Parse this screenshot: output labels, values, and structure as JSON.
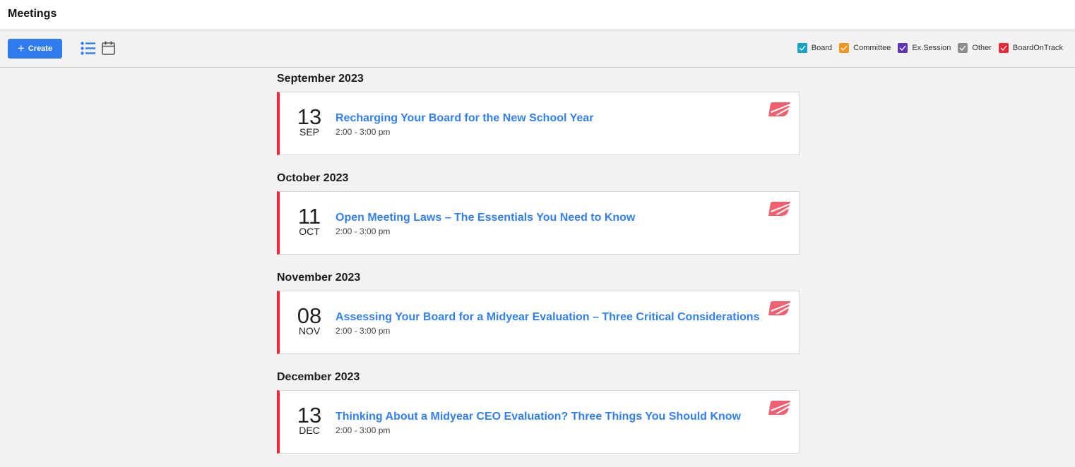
{
  "header": {
    "title": "Meetings"
  },
  "toolbar": {
    "create_label": "Create",
    "create_icon": "plus-icon",
    "views": [
      {
        "name": "list-view",
        "icon": "list-icon",
        "active": true
      },
      {
        "name": "calendar-view",
        "icon": "calendar-icon",
        "active": false
      }
    ],
    "legend": [
      {
        "label": "Board",
        "color": "#16a4c3",
        "checked": true
      },
      {
        "label": "Committee",
        "color": "#f7941d",
        "checked": true
      },
      {
        "label": "Ex.Session",
        "color": "#5e35b8",
        "checked": true
      },
      {
        "label": "Other",
        "color": "#8e8e8e",
        "checked": true
      },
      {
        "label": "BoardOnTrack",
        "color": "#ee2737",
        "checked": true
      }
    ]
  },
  "colors": {
    "accent": "#2f7bef",
    "link": "#3280ee",
    "boardontrack": "#ee2737",
    "boardontrack_icon": "#f06070"
  },
  "months": [
    {
      "heading": "September 2023",
      "meetings": [
        {
          "day": "13",
          "month": "SEP",
          "title": "Recharging Your Board for the New School Year",
          "time": "2:00 - 3:00 pm",
          "type": "BoardOnTrack",
          "icon": "boardontrack-logo-icon"
        }
      ]
    },
    {
      "heading": "October 2023",
      "meetings": [
        {
          "day": "11",
          "month": "OCT",
          "title": "Open Meeting Laws – The Essentials You Need to Know",
          "time": "2:00 - 3:00 pm",
          "type": "BoardOnTrack",
          "icon": "boardontrack-logo-icon"
        }
      ]
    },
    {
      "heading": "November 2023",
      "meetings": [
        {
          "day": "08",
          "month": "NOV",
          "title": "Assessing Your Board for a Midyear Evaluation – Three Critical Considerations",
          "time": "2:00 - 3:00 pm",
          "type": "BoardOnTrack",
          "icon": "boardontrack-logo-icon"
        }
      ]
    },
    {
      "heading": "December 2023",
      "meetings": [
        {
          "day": "13",
          "month": "DEC",
          "title": "Thinking About a Midyear CEO Evaluation? Three Things You Should Know",
          "time": "2:00 - 3:00 pm",
          "type": "BoardOnTrack",
          "icon": "boardontrack-logo-icon"
        }
      ]
    }
  ]
}
